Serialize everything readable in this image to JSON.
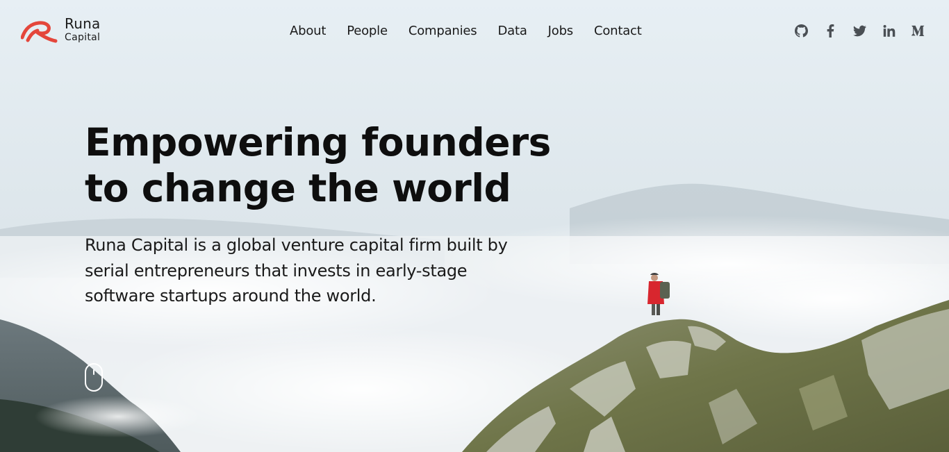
{
  "brand": {
    "name_line1": "Runa",
    "name_line2": "Capital",
    "accent_color": "#e4463b"
  },
  "nav": {
    "items": [
      {
        "label": "About"
      },
      {
        "label": "People"
      },
      {
        "label": "Companies"
      },
      {
        "label": "Data"
      },
      {
        "label": "Jobs"
      },
      {
        "label": "Contact"
      }
    ]
  },
  "social": [
    {
      "icon": "github-icon"
    },
    {
      "icon": "facebook-icon"
    },
    {
      "icon": "twitter-icon"
    },
    {
      "icon": "linkedin-icon"
    },
    {
      "icon": "medium-icon"
    }
  ],
  "hero": {
    "headline_line1": "Empowering founders",
    "headline_line2": "to change the world",
    "description_line1": "Runa Capital is a global venture capital firm built by",
    "description_line2": "serial entrepreneurs that invests in early-stage",
    "description_line3": "software startups around the world.",
    "scroll_indicator": "mouse-scroll-icon"
  }
}
